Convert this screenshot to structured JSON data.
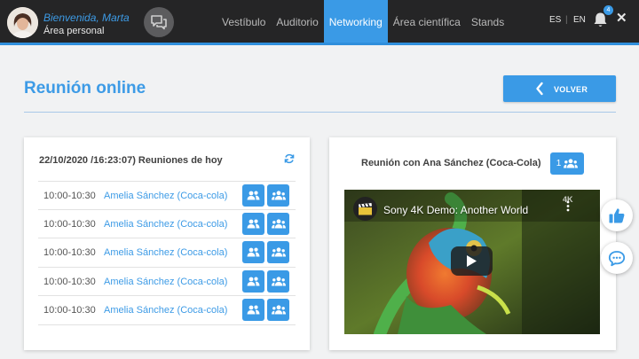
{
  "header": {
    "welcome": "Bienvenida, Marta",
    "personal_area": "Área personal",
    "nav": [
      "Vestíbulo",
      "Auditorio",
      "Networking",
      "Área científica",
      "Stands"
    ],
    "active_nav": "Networking",
    "languages": [
      "ES",
      "EN"
    ],
    "notification_count": "4"
  },
  "page": {
    "title": "Reunión online",
    "back_label": "VOLVER"
  },
  "schedule": {
    "title": "22/10/2020 /16:23:07) Reuniones de hoy",
    "rows": [
      {
        "time": "10:00-10:30",
        "name": "Amelia Sánchez (Coca-cola)"
      },
      {
        "time": "10:00-10:30",
        "name": "Amelia Sánchez (Coca-cola)"
      },
      {
        "time": "10:00-10:30",
        "name": "Amelia Sánchez (Coca-cola)"
      },
      {
        "time": "10:00-10:30",
        "name": "Amelia Sánchez (Coca-cola)"
      },
      {
        "time": "10:00-10:30",
        "name": "Amelia Sánchez (Coca-cola)"
      }
    ]
  },
  "meeting": {
    "title": "Reunión con Ana Sánchez (Coca-Cola)",
    "participants": "1",
    "video_title": "Sony 4K Demo: Another World",
    "video_badge": "4K"
  },
  "colors": {
    "accent": "#3a9ae6",
    "header_bg": "#252526"
  },
  "icons": [
    "chat-bubbles-icon",
    "bell-icon",
    "close-icon",
    "chevron-left-icon",
    "refresh-icon",
    "user-pair-icon",
    "user-group-icon",
    "play-icon",
    "more-vertical-icon",
    "thumbs-up-icon",
    "speech-bubble-icon"
  ]
}
